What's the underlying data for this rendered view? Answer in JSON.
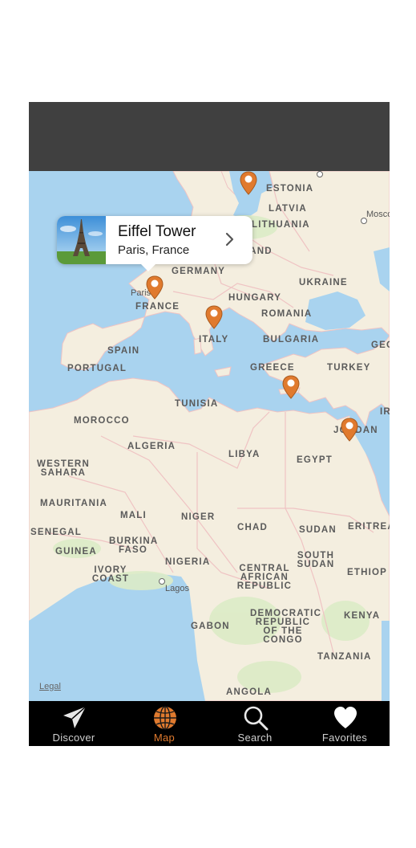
{
  "callout": {
    "title": "Eiffel Tower",
    "subtitle": "Paris, France"
  },
  "map": {
    "legal": "Legal",
    "countries": [
      "ESTONIA",
      "LATVIA",
      "LITHUANIA",
      "POLAND",
      "GERMANY",
      "UKRAINE",
      "FRANCE",
      "HUNGARY",
      "ROMANIA",
      "ITALY",
      "SPAIN",
      "PORTUGAL",
      "BULGARIA",
      "GREECE",
      "TURKEY",
      "GEO",
      "TUNISIA",
      "MOROCCO",
      "IR",
      "ALGERIA",
      "LIBYA",
      "EGYPT",
      "JORDAN",
      "WESTERN SAHARA",
      "MAURITANIA",
      "MALI",
      "NIGER",
      "CHAD",
      "SUDAN",
      "ERITREA",
      "SENEGAL",
      "BURKINA FASO",
      "GUINEA",
      "NIGERIA",
      "SOUTH SUDAN",
      "ETHIOP",
      "IVORY COAST",
      "CENTRAL AFRICAN REPUBLIC",
      "GABON",
      "DEMOCRATIC REPUBLIC OF THE CONGO",
      "KENYA",
      "TANZANIA",
      "ANGOLA"
    ],
    "cities": [
      "Paris",
      "Lagos",
      "Mosco"
    ]
  },
  "tabbar": {
    "tabs": [
      {
        "label": "Discover",
        "icon": "paper-plane-icon"
      },
      {
        "label": "Map",
        "icon": "globe-icon",
        "active": true
      },
      {
        "label": "Search",
        "icon": "search-icon"
      },
      {
        "label": "Favorites",
        "icon": "heart-icon"
      }
    ]
  },
  "colors": {
    "accent": "#e07a2e",
    "water": "#a9d3ef",
    "land": "#f4eedf",
    "navbar": "#404040",
    "tabbar": "#000000"
  }
}
